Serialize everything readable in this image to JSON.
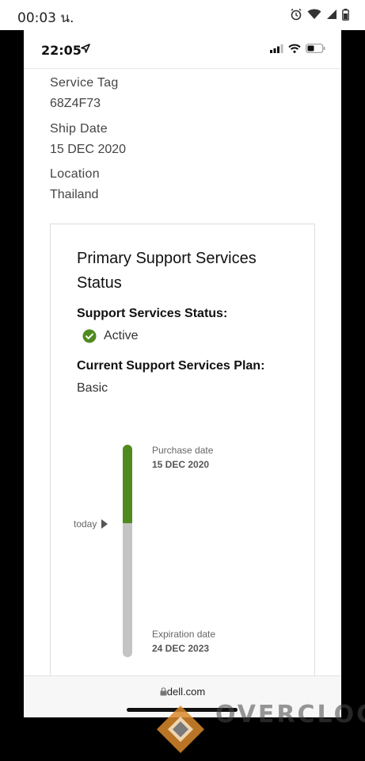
{
  "android_status": {
    "time": "00:03 น."
  },
  "ios_status": {
    "time": "22:05"
  },
  "fields": [
    {
      "label": "Service Tag",
      "value": "68Z4F73"
    },
    {
      "label": "Ship Date",
      "value": "15 DEC 2020"
    },
    {
      "label": "Location",
      "value": "Thailand"
    }
  ],
  "card": {
    "title": "Primary Support Services Status",
    "status_label": "Support Services Status:",
    "status_value": "Active",
    "plan_label": "Current Support Services Plan:",
    "plan_value": "Basic",
    "timeline": {
      "today_label": "today",
      "purchase_caption": "Purchase date",
      "purchase_date": "15 DEC 2020",
      "expiration_caption": "Expiration date",
      "expiration_date": "24 DEC 2023",
      "elapsed_fraction": 0.37
    }
  },
  "browser": {
    "url": "dell.com"
  },
  "watermark": {
    "text": "OVERCLOC"
  },
  "colors": {
    "active_green": "#4f8a1f",
    "track_gray": "#c4c4c4"
  }
}
